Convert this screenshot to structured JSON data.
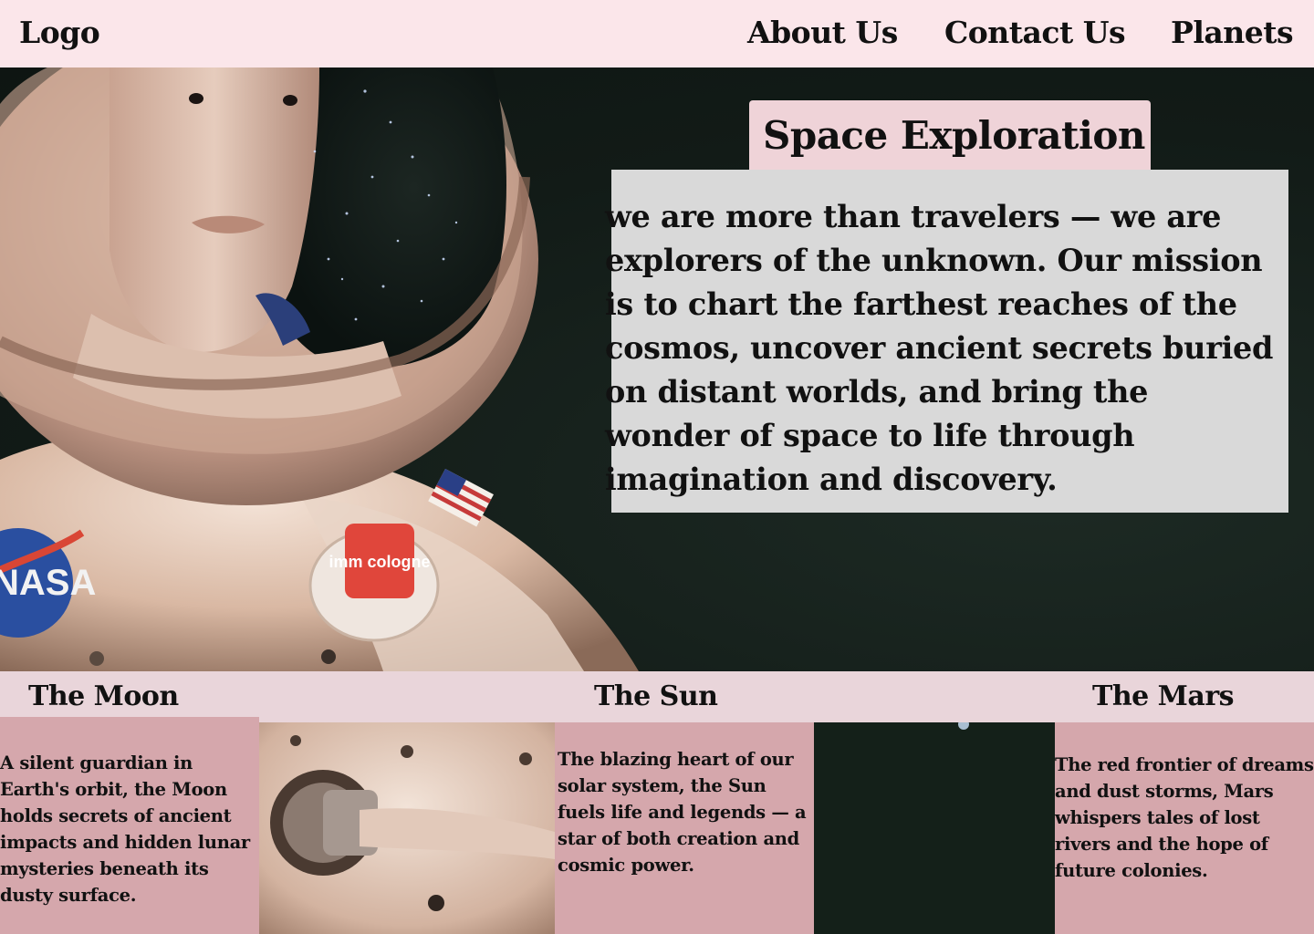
{
  "header": {
    "logo": "Logo",
    "nav": [
      {
        "label": "About Us"
      },
      {
        "label": "Contact Us"
      },
      {
        "label": "Planets"
      }
    ]
  },
  "hero": {
    "title": "Space Exploration",
    "body": "we are more than travelers — we are explorers of the unknown. Our mission is to chart the farthest reaches of the cosmos, uncover ancient secrets buried on distant worlds, and bring the wonder of space to life through imagination and discovery.",
    "image_badges": {
      "agency": "NASA",
      "patch": "imm cologne"
    }
  },
  "planets": [
    {
      "name": "The Moon",
      "description": "A silent guardian in Earth's orbit, the Moon holds secrets of ancient impacts and hidden lunar mysteries beneath its dusty surface."
    },
    {
      "name": "The Sun",
      "description": "The blazing heart of our solar system, the Sun fuels life and legends — a star of both creation and cosmic power."
    },
    {
      "name": "The Mars",
      "description": "The red frontier of dreams and dust storms, Mars whispers tales of lost rivers and the hope of future colonies."
    }
  ],
  "colors": {
    "header_bg": "#fbe6ea",
    "title_tab": "#efd3d8",
    "text_panel": "#d9d9d9",
    "strip_bg": "#e9d5da",
    "card_bg": "#d5a7ac",
    "space_bg": "#121b17"
  }
}
